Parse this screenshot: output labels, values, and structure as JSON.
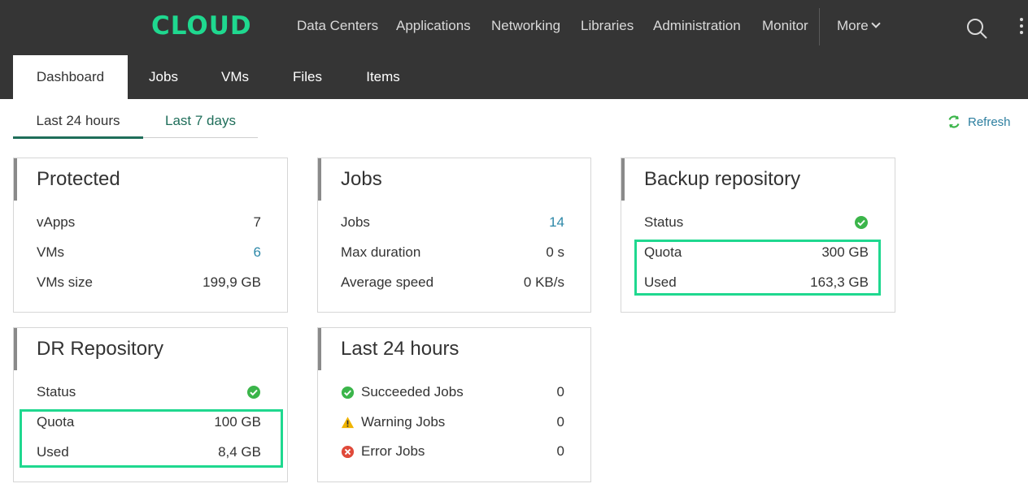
{
  "app": {
    "logo": "CLOUD"
  },
  "nav": {
    "items": [
      "Data Centers",
      "Applications",
      "Networking",
      "Libraries",
      "Administration",
      "Monitor"
    ],
    "more_label": "More"
  },
  "subtabs": [
    "Dashboard",
    "Jobs",
    "VMs",
    "Files",
    "Items"
  ],
  "range": {
    "tabs": [
      "Last 24 hours",
      "Last 7 days"
    ],
    "selected": "Last 24 hours",
    "refresh_label": "Refresh"
  },
  "cards": {
    "protected": {
      "title": "Protected",
      "rows": [
        {
          "label": "vApps",
          "value": "7"
        },
        {
          "label": "VMs",
          "value": "6"
        },
        {
          "label": "VMs size",
          "value": "199,9 GB"
        }
      ]
    },
    "jobs": {
      "title": "Jobs",
      "rows": [
        {
          "label": "Jobs",
          "value": "14"
        },
        {
          "label": "Max duration",
          "value": "0 s"
        },
        {
          "label": "Average speed",
          "value": "0 KB/s"
        }
      ]
    },
    "backup": {
      "title": "Backup repository",
      "rows": [
        {
          "label": "Status",
          "value": "ok"
        },
        {
          "label": "Quota",
          "value": "300 GB"
        },
        {
          "label": "Used",
          "value": "163,3 GB"
        }
      ]
    },
    "dr": {
      "title": "DR Repository",
      "rows": [
        {
          "label": "Status",
          "value": "ok"
        },
        {
          "label": "Quota",
          "value": "100 GB"
        },
        {
          "label": "Used",
          "value": "8,4 GB"
        }
      ]
    },
    "last24": {
      "title": "Last 24 hours",
      "rows": [
        {
          "label": "Succeeded Jobs",
          "value": "0",
          "icon": "success-icon"
        },
        {
          "label": "Warning Jobs",
          "value": "0",
          "icon": "warning-icon"
        },
        {
          "label": "Error Jobs",
          "value": "0",
          "icon": "error-icon"
        }
      ]
    }
  },
  "colors": {
    "topbar": "#353535",
    "brand": "#1fd88f",
    "link": "#2d88a8",
    "highlight": "#1fd88f",
    "success": "#3bb54a",
    "error": "#e04a3a",
    "warning": "#f0b400"
  }
}
